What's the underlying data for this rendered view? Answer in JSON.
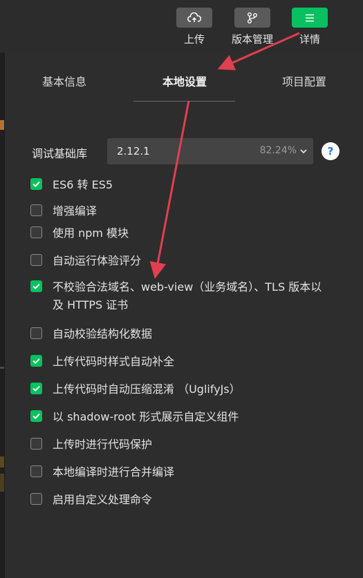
{
  "toolbar": {
    "upload_label": "上传",
    "version_label": "版本管理",
    "details_label": "详情"
  },
  "tabs": [
    {
      "label": "基本信息",
      "active": false
    },
    {
      "label": "本地设置",
      "active": true
    },
    {
      "label": "项目配置",
      "active": false
    }
  ],
  "debug_lib": {
    "label": "调试基础库",
    "version": "2.12.1",
    "percent": "82.24%",
    "help": "?"
  },
  "options": [
    {
      "label": "ES6 转 ES5",
      "checked": true
    },
    {
      "label": "增强编译",
      "checked": false
    },
    {
      "label": "使用 npm 模块",
      "checked": false
    },
    {
      "label": "自动运行体验评分",
      "checked": false
    },
    {
      "label": "不校验合法域名、web-view（业务域名）、TLS 版本以及 HTTPS 证书",
      "checked": true
    },
    {
      "label": "自动校验结构化数据",
      "checked": false
    },
    {
      "label": "上传代码时样式自动补全",
      "checked": true
    },
    {
      "label": "上传代码时自动压缩混淆 （UglifyJs）",
      "checked": true
    },
    {
      "label": "以 shadow-root 形式展示自定义组件",
      "checked": true
    },
    {
      "label": "上传时进行代码保护",
      "checked": false
    },
    {
      "label": "本地编译时进行合并编译",
      "checked": false
    },
    {
      "label": "启用自定义处理命令",
      "checked": false
    }
  ],
  "colors": {
    "accent_green": "#07c160",
    "arrow_red": "#e0404f"
  }
}
